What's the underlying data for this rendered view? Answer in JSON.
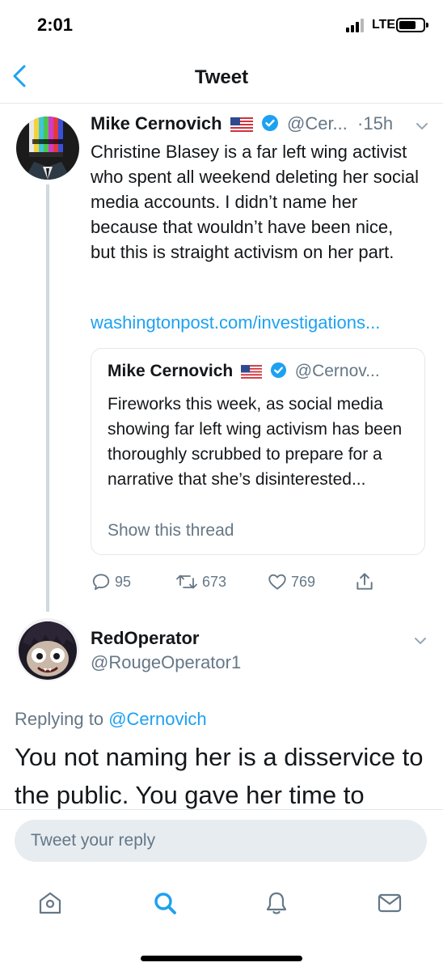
{
  "status_bar": {
    "time": "2:01",
    "network": "LTE"
  },
  "nav": {
    "title": "Tweet"
  },
  "tweet": {
    "author_name": "Mike Cernovich",
    "handle": "@Cer...",
    "time": "·15h",
    "text": "Christine Blasey is a far left wing activist who spent all weekend deleting her social media accounts. I didn’t name her because that wouldn’t have been nice, but this is straight activism on her part.",
    "link": "washingtonpost.com/investigations...",
    "quote": {
      "author_name": "Mike Cernovich",
      "handle": "@Cernov...",
      "text": "Fireworks this week, as social media showing far left wing activism has been thoroughly scrubbed to prepare for a narrative that she’s disinterested...",
      "show_thread": "Show this thread"
    },
    "actions": {
      "replies": "95",
      "retweets": "673",
      "likes": "769"
    }
  },
  "reply": {
    "author_name": "RedOperator",
    "handle": "@RougeOperator1",
    "replying_to_prefix": "Replying to ",
    "replying_to_handle": "@Cernovich",
    "text": "You not naming her is a disservice to the public. You gave her time to"
  },
  "composer": {
    "placeholder": "Tweet your reply"
  },
  "tab_bar": {
    "items": [
      "home-icon",
      "search-icon",
      "notifications-icon",
      "messages-icon"
    ],
    "active": "search-icon"
  },
  "colors": {
    "accent": "#1da1f2",
    "secondary_text": "#657786",
    "primary_text": "#14171a",
    "border": "#e1e8ed"
  }
}
